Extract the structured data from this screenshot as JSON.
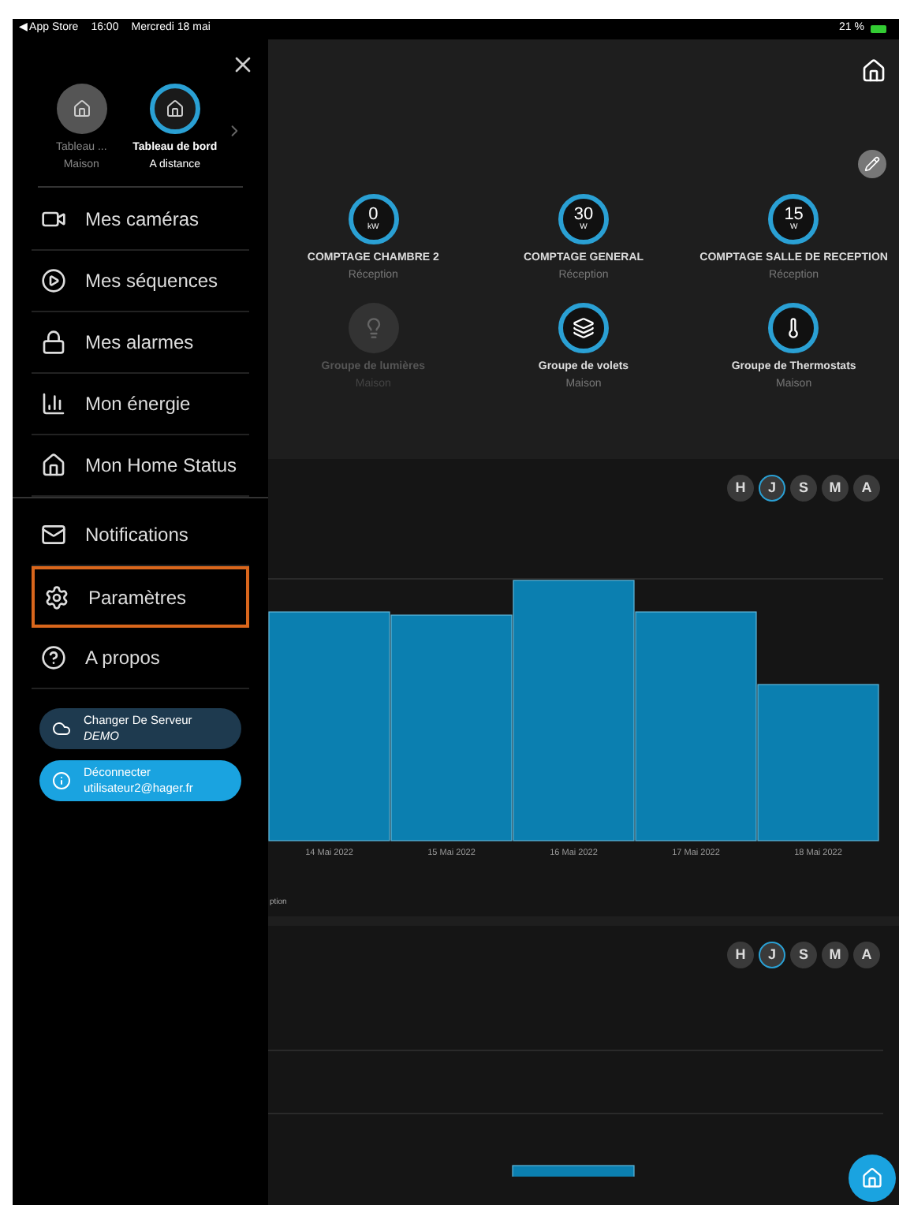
{
  "status_bar": {
    "back": "◀ App Store",
    "time": "16:00",
    "date": "Mercredi 18 mai",
    "battery": "21 %"
  },
  "sidebar": {
    "dashboards": [
      {
        "title": "Tableau ...",
        "subtitle": "Maison",
        "selected": false
      },
      {
        "title": "Tableau de bord",
        "subtitle": "A distance",
        "selected": true
      }
    ],
    "menu": [
      {
        "label": "Mes caméras",
        "selected": false
      },
      {
        "label": "Mes séquences",
        "selected": false
      },
      {
        "label": "Mes alarmes",
        "selected": false
      },
      {
        "label": "Mon énergie",
        "selected": false
      },
      {
        "label": "Mon Home Status",
        "selected": false
      }
    ],
    "menu_more": [
      {
        "label": "Notifications",
        "selected": false
      },
      {
        "label": "Paramètres",
        "selected": true
      },
      {
        "label": "A propos",
        "selected": false
      }
    ],
    "actions": [
      {
        "kind": "server",
        "title": "Changer De Serveur",
        "detail": "DEMO"
      },
      {
        "kind": "logout",
        "title": "Déconnecter",
        "detail": "utilisateur2@hager.fr"
      }
    ]
  },
  "tiles": [
    {
      "kind": "gauge",
      "value": "0",
      "unit": "kW",
      "title": "COMPTAGE CHAMBRE 2",
      "subtitle": "Réception"
    },
    {
      "kind": "gauge",
      "value": "30",
      "unit": "W",
      "title": "COMPTAGE GENERAL",
      "subtitle": "Réception"
    },
    {
      "kind": "gauge",
      "value": "15",
      "unit": "W",
      "title": "COMPTAGE SALLE DE RECEPTION",
      "subtitle": "Réception"
    },
    {
      "kind": "lights",
      "title": "Groupe de lumières",
      "subtitle": "Maison",
      "disabled": true
    },
    {
      "kind": "shutters",
      "title": "Groupe de volets",
      "subtitle": "Maison",
      "disabled": false
    },
    {
      "kind": "thermostats",
      "title": "Groupe de Thermostats",
      "subtitle": "Maison",
      "disabled": false
    }
  ],
  "charts": [
    {
      "periods": [
        {
          "label": "H",
          "selected": false
        },
        {
          "label": "J",
          "selected": true
        },
        {
          "label": "S",
          "selected": false
        },
        {
          "label": "M",
          "selected": false
        },
        {
          "label": "A",
          "selected": false
        }
      ],
      "dates": [
        "14 Mai 2022",
        "15 Mai 2022",
        "16 Mai 2022",
        "17 Mai 2022",
        "18 Mai 2022"
      ],
      "caption": "ption"
    },
    {
      "periods": [
        {
          "label": "H",
          "selected": false
        },
        {
          "label": "J",
          "selected": true
        },
        {
          "label": "S",
          "selected": false
        },
        {
          "label": "M",
          "selected": false
        },
        {
          "label": "A",
          "selected": false
        }
      ]
    }
  ]
}
